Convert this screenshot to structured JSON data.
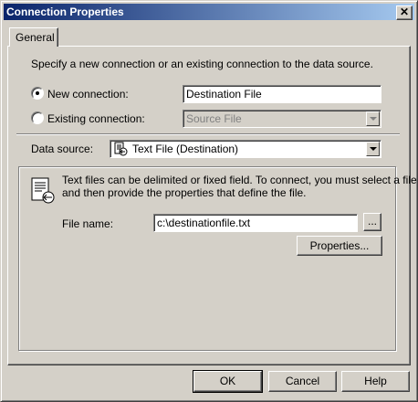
{
  "window": {
    "title": "Connection Properties"
  },
  "tabs": [
    {
      "label": "General"
    }
  ],
  "intro": "Specify a new connection or an existing connection to the data source.",
  "new_connection": {
    "label": "New connection:",
    "value": "Destination File",
    "selected": true
  },
  "existing_connection": {
    "label": "Existing connection:",
    "value": "Source File",
    "selected": false
  },
  "data_source": {
    "label": "Data source:",
    "value": "Text File (Destination)",
    "icon": "text-file-destination-icon"
  },
  "info": {
    "line1": "Text files can be delimited or fixed field. To connect, you must select a file",
    "line2": "and then provide the properties that define the file."
  },
  "file": {
    "label": "File name:",
    "value": "c:\\destinationfile.txt",
    "browse_label": "...",
    "properties_label": "Properties..."
  },
  "buttons": {
    "ok": "OK",
    "cancel": "Cancel",
    "help": "Help"
  }
}
